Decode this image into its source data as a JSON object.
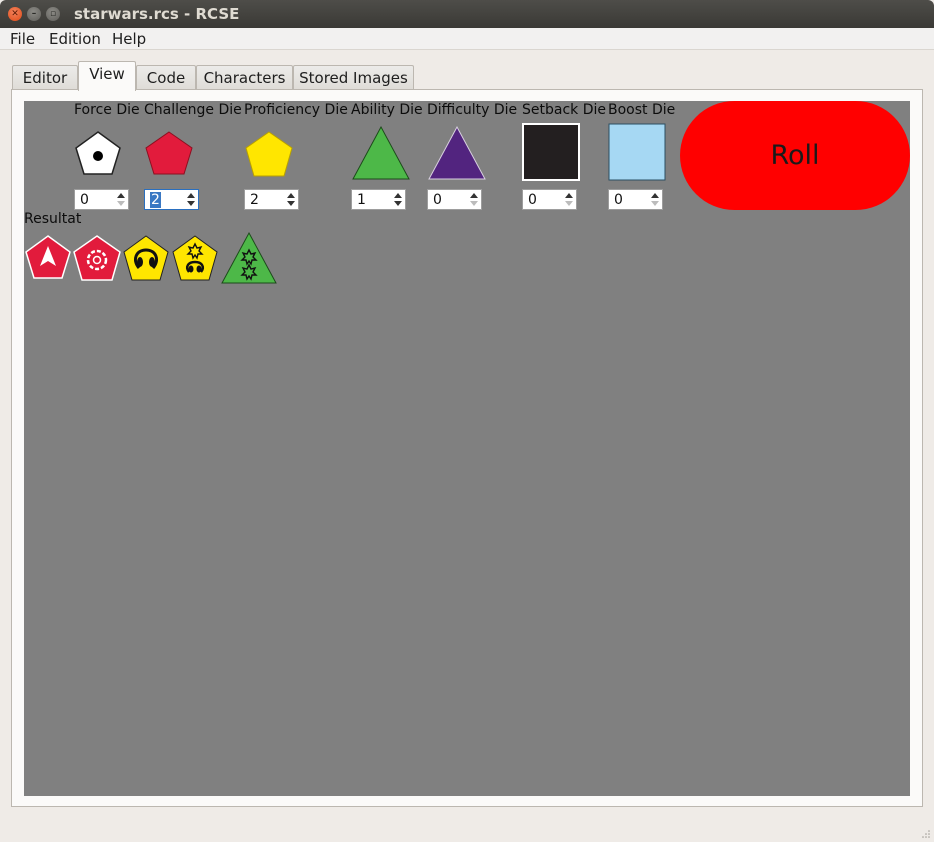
{
  "window": {
    "title": "starwars.rcs - RCSE"
  },
  "menu": [
    "File",
    "Edition",
    "Help"
  ],
  "tabs": [
    "Editor",
    "View",
    "Code",
    "Characters",
    "Stored Images"
  ],
  "dice": [
    {
      "label": "Force Die",
      "value": "0",
      "icon": "force-die-icon"
    },
    {
      "label": "Challenge Die",
      "value": "2",
      "icon": "challenge-die-icon"
    },
    {
      "label": "Proficiency Die",
      "value": "2",
      "icon": "proficiency-die-icon"
    },
    {
      "label": "Ability Die",
      "value": "1",
      "icon": "ability-die-icon"
    },
    {
      "label": "Difficulty Die",
      "value": "0",
      "icon": "difficulty-die-icon"
    },
    {
      "label": "Setback Die",
      "value": "0",
      "icon": "setback-die-icon"
    },
    {
      "label": "Boost Die",
      "value": "0",
      "icon": "boost-die-icon"
    }
  ],
  "roll_label": "Roll",
  "resultat_label": "Resultat",
  "results": [
    "challenge-failure-icon",
    "challenge-despair-icon",
    "proficiency-advantage-icon",
    "proficiency-success-advantage-icon",
    "ability-double-success-icon"
  ],
  "colors": {
    "canvas": "#808080",
    "roll": "#ff0000",
    "challenge": "#e21b3c",
    "proficiency": "#ffe600",
    "ability": "#4db848",
    "difficulty": "#52247f",
    "setback": "#231f20",
    "boost": "#a6d8f3"
  }
}
